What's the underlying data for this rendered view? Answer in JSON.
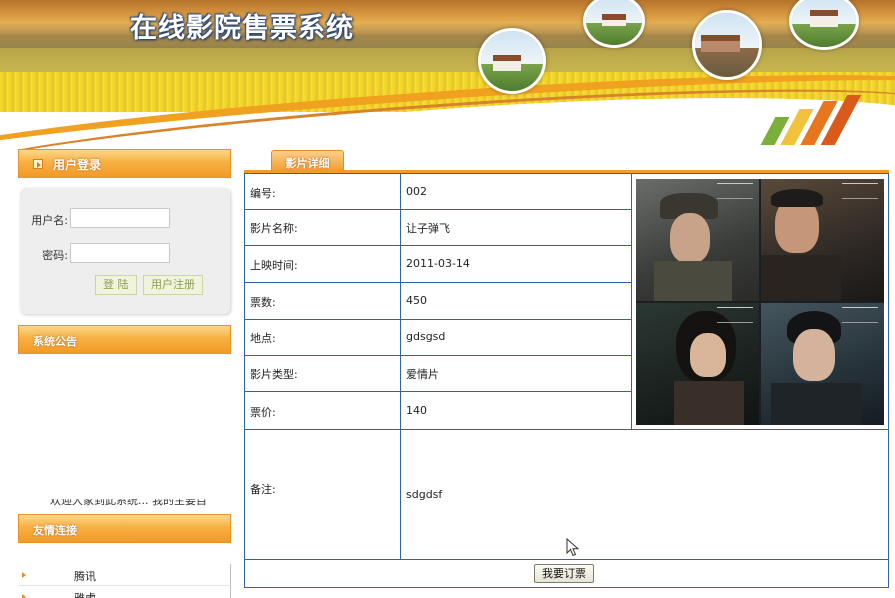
{
  "app": {
    "title": "在线影院售票系统"
  },
  "sidebar": {
    "login": {
      "header": "用户登录",
      "username_label": "用户名:",
      "username_value": "",
      "password_label": "密码:",
      "password_value": "",
      "login_button": "登 陆",
      "register_button": "用户注册"
    },
    "notice": {
      "header": "系统公告",
      "scroll_text": "欢迎大家到此系统... 我的主要目"
    },
    "links": {
      "header": "友情连接",
      "items": [
        "腾讯",
        "雅虎"
      ]
    }
  },
  "detail": {
    "tab": "影片详细",
    "fields": [
      {
        "label": "编号:",
        "value": "002"
      },
      {
        "label": "影片名称:",
        "value": "让子弹飞"
      },
      {
        "label": "上映时间:",
        "value": "2011-03-14"
      },
      {
        "label": "票数:",
        "value": "450"
      },
      {
        "label": "地点:",
        "value": "gdsgsd"
      },
      {
        "label": "影片类型:",
        "value": "爱情片"
      },
      {
        "label": "票价:",
        "value": "140"
      },
      {
        "label": "备注:",
        "value": "sdgdsf"
      }
    ],
    "order_button": "我要订票",
    "poster_icon": "movie-poster-image"
  },
  "colors": {
    "accent_orange": "#f29a2b",
    "table_border": "#2f63a8",
    "banner_yellow": "#f6dc2c"
  }
}
